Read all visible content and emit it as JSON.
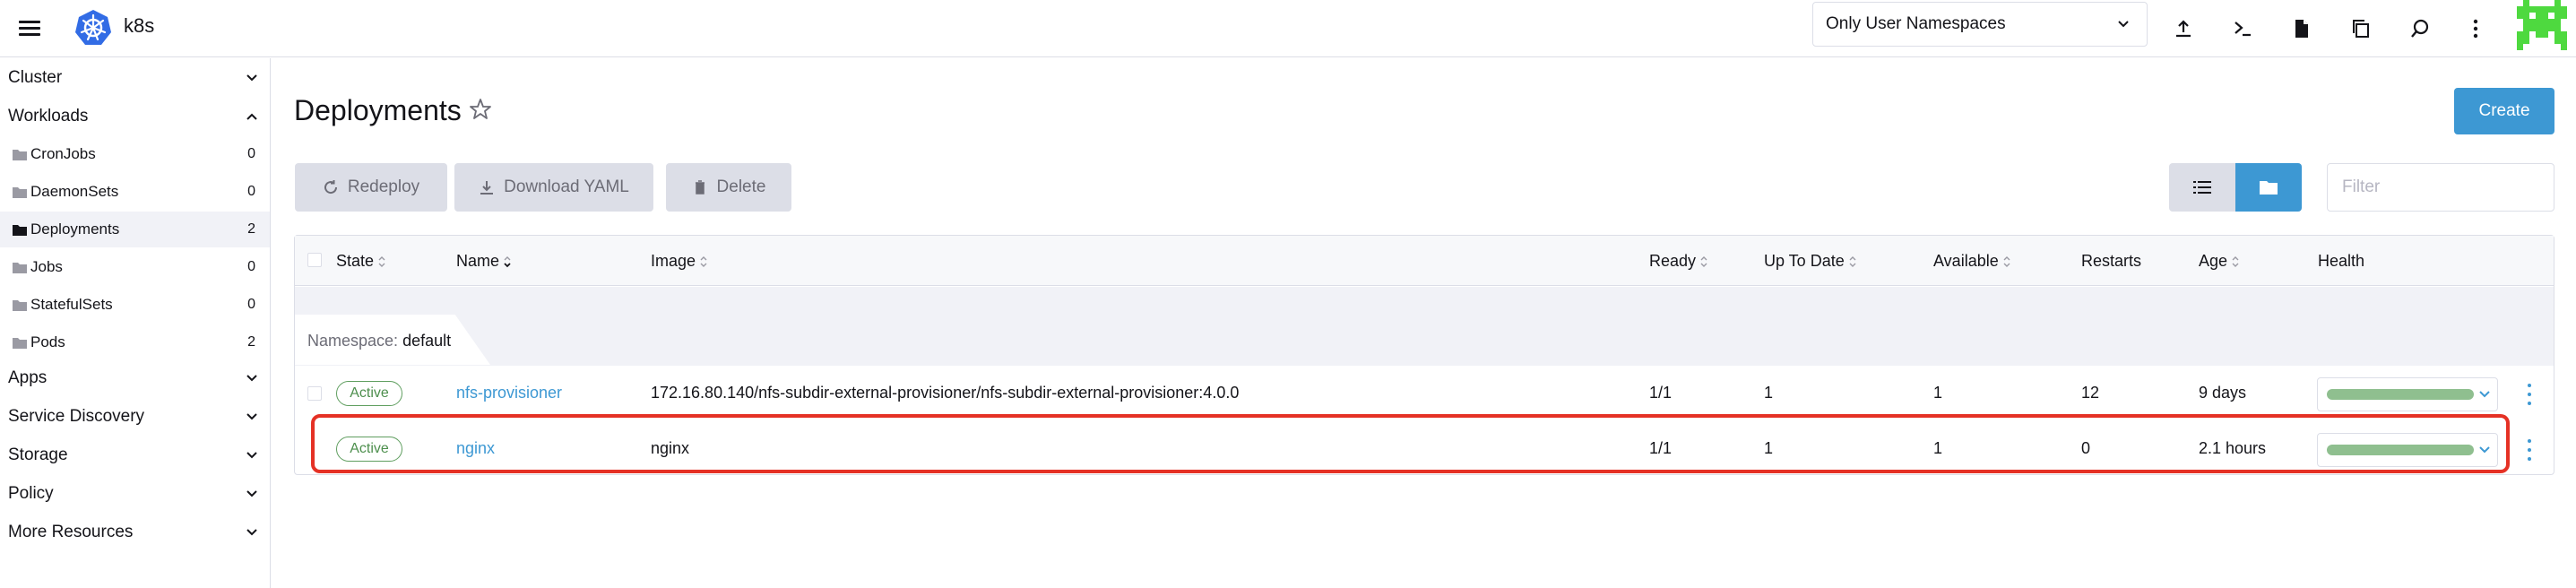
{
  "header": {
    "cluster_name": "k8s",
    "namespace_filter": "Only User Namespaces",
    "icons": [
      "hamburger-icon",
      "kubernetes-logo-icon",
      "upload-icon",
      "terminal-icon",
      "file-icon",
      "copy-icon",
      "search-icon",
      "more-vertical-icon",
      "avatar-icon"
    ],
    "accent_color": "#3d98d3"
  },
  "sidebar": {
    "groups": [
      {
        "label": "Cluster"
      },
      {
        "label": "Workloads"
      },
      {
        "label": "Apps"
      },
      {
        "label": "Service Discovery"
      },
      {
        "label": "Storage"
      },
      {
        "label": "Policy"
      },
      {
        "label": "More Resources"
      }
    ],
    "items": [
      {
        "label": "CronJobs",
        "count": "0"
      },
      {
        "label": "DaemonSets",
        "count": "0"
      },
      {
        "label": "Deployments",
        "count": "2"
      },
      {
        "label": "Jobs",
        "count": "0"
      },
      {
        "label": "StatefulSets",
        "count": "0"
      },
      {
        "label": "Pods",
        "count": "2"
      }
    ]
  },
  "main": {
    "title": "Deployments",
    "create_label": "Create",
    "buttons": {
      "redeploy": "Redeploy",
      "download": "Download YAML",
      "delete": "Delete"
    },
    "filter_placeholder": "Filter"
  },
  "table": {
    "columns": {
      "state": "State",
      "name": "Name",
      "image": "Image",
      "ready": "Ready",
      "uptodate": "Up To Date",
      "available": "Available",
      "restarts": "Restarts",
      "age": "Age",
      "health": "Health"
    },
    "group": {
      "prefix": "Namespace:",
      "name": "default"
    },
    "rows": [
      {
        "state": "Active",
        "name": "nfs-provisioner",
        "image": "172.16.80.140/nfs-subdir-external-provisioner/nfs-subdir-external-provisioner:4.0.0",
        "ready": "1/1",
        "uptodate": "1",
        "available": "1",
        "restarts": "12",
        "age": "9 days",
        "health_fraction": 1.0
      },
      {
        "state": "Active",
        "name": "nginx",
        "image": "nginx",
        "ready": "1/1",
        "uptodate": "1",
        "available": "1",
        "restarts": "0",
        "age": "2.1 hours",
        "health_fraction": 1.0
      }
    ],
    "status_color": "#5f9e5f",
    "highlight_color": "#e53125"
  }
}
